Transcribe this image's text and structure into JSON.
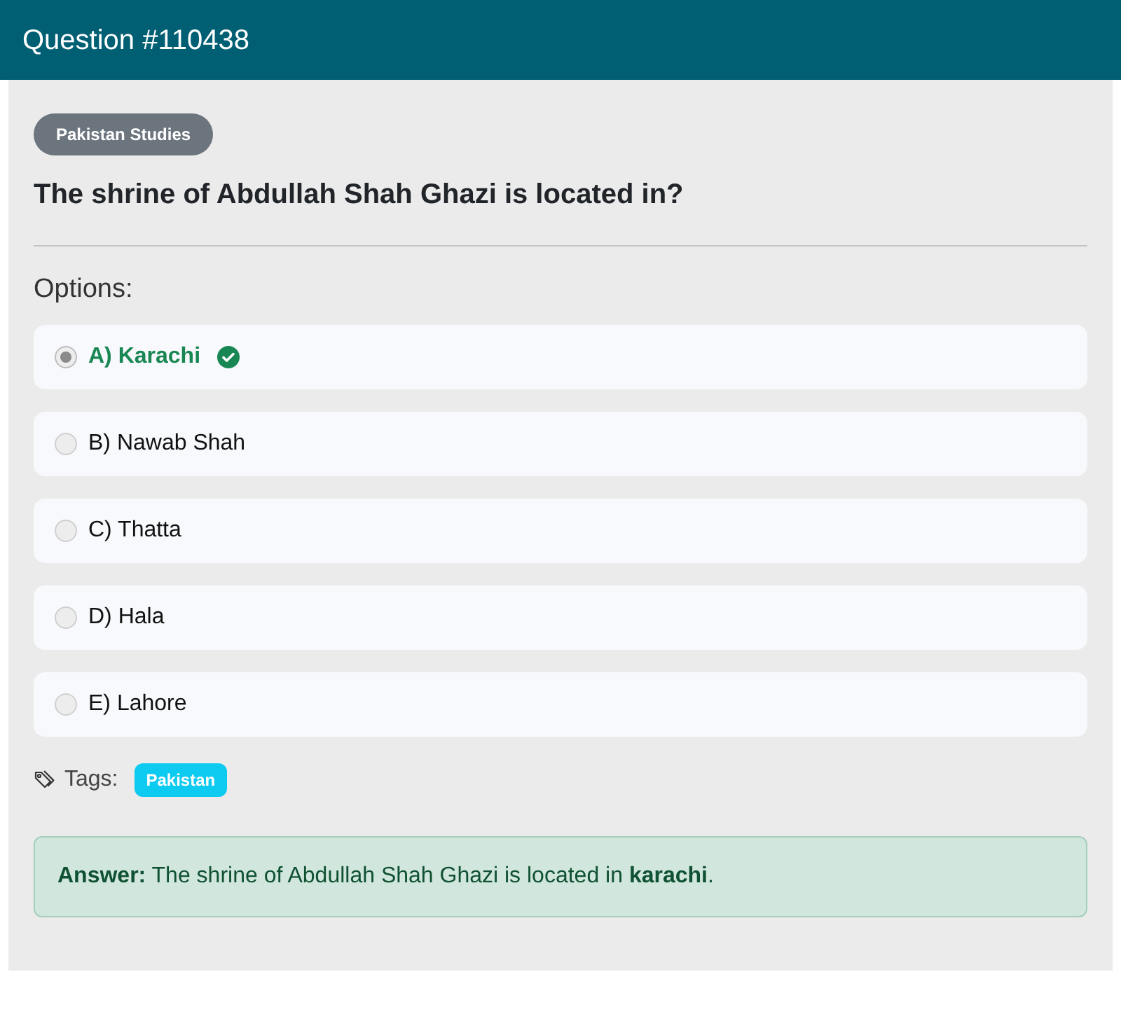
{
  "header": {
    "title": "Question #110438"
  },
  "question": {
    "category": "Pakistan Studies",
    "text": "The shrine of Abdullah Shah Ghazi is located in?"
  },
  "options_label": "Options:",
  "options": [
    {
      "label": "A) Karachi",
      "selected": true,
      "correct": true
    },
    {
      "label": "B) Nawab Shah",
      "selected": false,
      "correct": false
    },
    {
      "label": "C) Thatta",
      "selected": false,
      "correct": false
    },
    {
      "label": "D) Hala",
      "selected": false,
      "correct": false
    },
    {
      "label": "E) Lahore",
      "selected": false,
      "correct": false
    }
  ],
  "tags": {
    "label": "Tags:",
    "items": [
      "Pakistan"
    ]
  },
  "answer": {
    "text": "**Answer:** The shrine of Abdullah Shah Ghazi is located in **karachi**."
  }
}
